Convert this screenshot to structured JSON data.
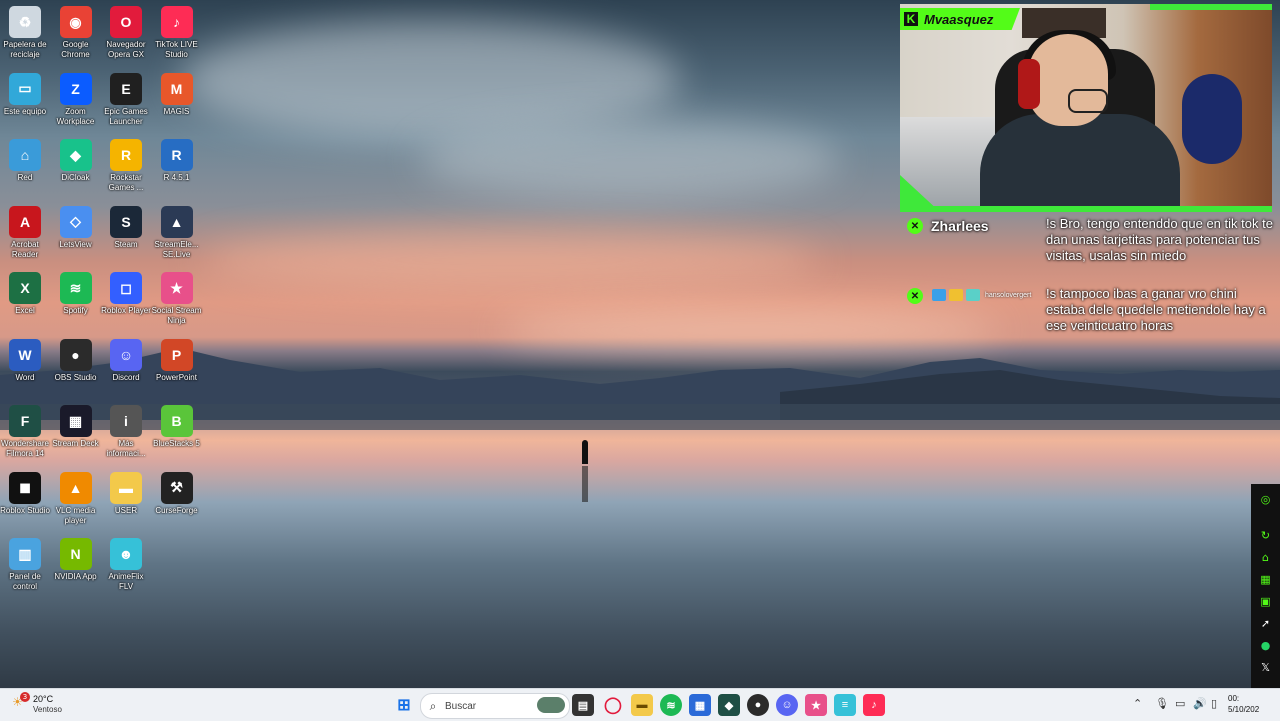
{
  "desktop_icons": [
    {
      "label": "Papelera de reciclaje",
      "icon": "recycle-bin-icon",
      "color": "#cfd8e0"
    },
    {
      "label": "Google Chrome",
      "icon": "chrome-icon",
      "color": "#e94235"
    },
    {
      "label": "Navegador Opera GX",
      "icon": "opera-gx-icon",
      "color": "#e21b3c"
    },
    {
      "label": "TikTok LIVE Studio",
      "icon": "tiktok-live-icon",
      "color": "#fe2c55"
    },
    {
      "label": "Este equipo",
      "icon": "computer-icon",
      "color": "#31a8d9"
    },
    {
      "label": "Zoom Workplace",
      "icon": "zoom-icon",
      "color": "#0b5cff"
    },
    {
      "label": "Epic Games Launcher",
      "icon": "epic-games-icon",
      "color": "#202020"
    },
    {
      "label": "MAGIS",
      "icon": "magis-icon",
      "color": "#e8572a"
    },
    {
      "label": "Red",
      "icon": "network-icon",
      "color": "#3a9bd9"
    },
    {
      "label": "DiCloak",
      "icon": "dicloak-icon",
      "color": "#18c28b"
    },
    {
      "label": "Rockstar Games ...",
      "icon": "rockstar-icon",
      "color": "#f5b400"
    },
    {
      "label": "R 4.5.1",
      "icon": "r-lang-icon",
      "color": "#276dc3"
    },
    {
      "label": "Acrobat Reader",
      "icon": "acrobat-icon",
      "color": "#c8161d"
    },
    {
      "label": "LetsView",
      "icon": "letsview-icon",
      "color": "#4a8ff0"
    },
    {
      "label": "Steam",
      "icon": "steam-icon",
      "color": "#1b2838"
    },
    {
      "label": "StreamEle... SE.Live",
      "icon": "streamelements-icon",
      "color": "#2b3a55"
    },
    {
      "label": "Excel",
      "icon": "excel-icon",
      "color": "#1d7044"
    },
    {
      "label": "Spotify",
      "icon": "spotify-icon",
      "color": "#1db954"
    },
    {
      "label": "Roblox Player",
      "icon": "roblox-player-icon",
      "color": "#335fff"
    },
    {
      "label": "Social Stream Ninja",
      "icon": "social-stream-icon",
      "color": "#e8508a"
    },
    {
      "label": "Word",
      "icon": "word-icon",
      "color": "#2b5cc0"
    },
    {
      "label": "OBS Studio",
      "icon": "obs-icon",
      "color": "#2b2b2b"
    },
    {
      "label": "Discord",
      "icon": "discord-icon",
      "color": "#5865f2"
    },
    {
      "label": "PowerPoint",
      "icon": "powerpoint-icon",
      "color": "#d24726"
    },
    {
      "label": "Wondershare Filmora 14",
      "icon": "filmora-icon",
      "color": "#1f4f45"
    },
    {
      "label": "Stream Deck",
      "icon": "stream-deck-icon",
      "color": "#1a1a2a"
    },
    {
      "label": "Más informaci...",
      "icon": "info-icon",
      "color": "#555555"
    },
    {
      "label": "BlueStacks 5",
      "icon": "bluestacks-icon",
      "color": "#5ac53a"
    },
    {
      "label": "Roblox Studio",
      "icon": "roblox-studio-icon",
      "color": "#111111"
    },
    {
      "label": "VLC media player",
      "icon": "vlc-icon",
      "color": "#f08a00"
    },
    {
      "label": "USER",
      "icon": "folder-icon",
      "color": "#f3c94a"
    },
    {
      "label": "CurseForge",
      "icon": "curseforge-icon",
      "color": "#222222"
    },
    {
      "label": "Panel de control",
      "icon": "control-panel-icon",
      "color": "#4aa3df"
    },
    {
      "label": "NVIDIA App",
      "icon": "nvidia-icon",
      "color": "#76b900"
    },
    {
      "label": "AnimeFlix FLV",
      "icon": "animeflix-icon",
      "color": "#36c1d8"
    }
  ],
  "stream": {
    "streamer_name": "Mvaasquez",
    "accent": "#53fc18",
    "chat": [
      {
        "user": "Zharlees",
        "message": "!s Bro, tengo entenddo que en tik tok te dan unas tarjetitas para potenciar tus visitas, usalas sin miedo"
      },
      {
        "user": "hansolovergert",
        "message": "!s tampoco ibas a ganar vro chini estaba dele quedele metiendole hay a ese veinticuatro horas"
      }
    ]
  },
  "taskbar": {
    "weather_badge": "3",
    "weather_temp": "20°C",
    "weather_desc": "Ventoso",
    "search_placeholder": "Buscar",
    "time": "00:",
    "date": "5/10/202"
  }
}
